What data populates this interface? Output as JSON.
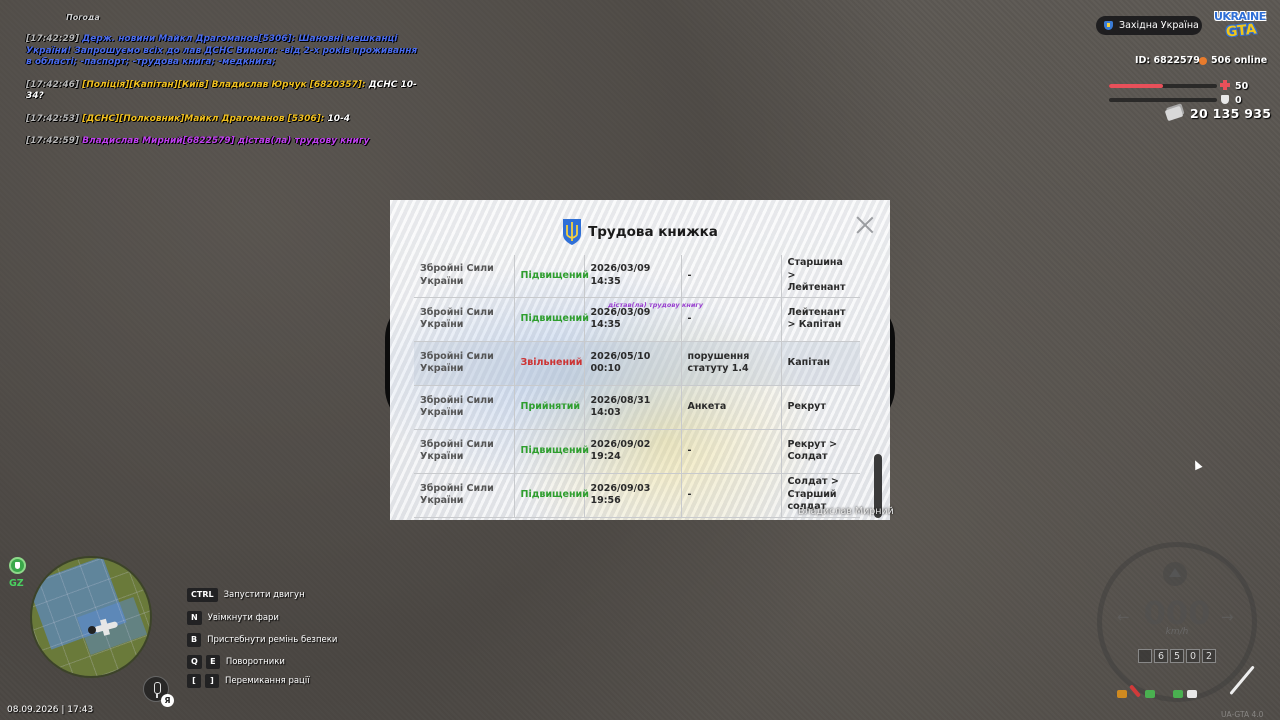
{
  "chat": {
    "first_line": "Погода",
    "lines": [
      {
        "ts": "[17:42:29]",
        "body": "Держ. новини Майкл Драгоманов[5306]: Шановні мешканці України! Запрошуємо всіх до лав ДСНС Вимоги: -від 2-х років проживання в області; -паспорт; -трудова книга; -медкнига;",
        "color": "blue"
      },
      {
        "ts": "[17:42:46]",
        "body": "[Поліція][Капітан][Київ] Владислав Юрчук [6820357]:",
        "tail": " ДСНС 10-34?",
        "color": "yellow"
      },
      {
        "ts": "[17:42:53]",
        "body": "[ДСНС][Полковник]Майкл Драгоманов [5306]:",
        "tail": " 10-4",
        "color": "yellow"
      },
      {
        "ts": "[17:42:59]",
        "body": "Владислав Мирний[6822579] дістав(ла) трудову книгу",
        "color": "purple"
      }
    ]
  },
  "hud": {
    "region": "Західна Україна",
    "logo_top": "UKRAINE",
    "logo_bottom": "GTA",
    "id_label": "ID: 6822579",
    "online": "506 online",
    "health": 50,
    "armor": 0,
    "money": "20 135 935"
  },
  "modal": {
    "title": "Трудова книжка",
    "overlay_text": "дістав(ла) трудову книгу",
    "player_name": "Владислав Мирний",
    "rows": [
      {
        "org": "Збройні Сили України",
        "status": "Підвищений",
        "status_type": "up",
        "date": "2026/03/09 14:35",
        "reason": "-",
        "rank": "Старшина > Лейтенант"
      },
      {
        "org": "Збройні Сили України",
        "status": "Підвищений",
        "status_type": "up",
        "date": "2026/03/09 14:35",
        "reason": "-",
        "rank": "Лейтенант > Капітан"
      },
      {
        "org": "Збройні Сили України",
        "status": "Звільнений",
        "status_type": "down",
        "date": "2026/05/10 00:10",
        "reason": "порушення статуту 1.4",
        "rank": "Капітан"
      },
      {
        "org": "Збройні Сили України",
        "status": "Прийнятий",
        "status_type": "up",
        "date": "2026/08/31 14:03",
        "reason": "Анкета",
        "rank": "Рекрут"
      },
      {
        "org": "Збройні Сили України",
        "status": "Підвищений",
        "status_type": "up",
        "date": "2026/09/02 19:24",
        "reason": "-",
        "rank": "Рекрут > Солдат"
      },
      {
        "org": "Збройні Сили України",
        "status": "Підвищений",
        "status_type": "up",
        "date": "2026/09/03 19:56",
        "reason": "-",
        "rank": "Солдат > Старший солдат"
      }
    ]
  },
  "minimap": {
    "zone_label": "GZ",
    "lang": "Я",
    "datetime": "08.09.2026 | 17:43"
  },
  "hints": [
    {
      "keys": [
        "CTRL"
      ],
      "label": "Запустити двигун"
    },
    {
      "keys": [
        "N"
      ],
      "label": "Увімкнути фари"
    },
    {
      "keys": [
        "B"
      ],
      "label": "Пристебнути ремінь безпеки"
    },
    {
      "keys": [
        "Q",
        "E"
      ],
      "label": "Поворотники"
    },
    {
      "keys": [
        "[",
        "]"
      ],
      "label": "Перемикання рації"
    }
  ],
  "speedometer": {
    "speed": "000",
    "unit": "km/h",
    "odometer": [
      "",
      "6",
      "5",
      "0",
      "2"
    ]
  },
  "version": "UA-GTA 4.0",
  "colors": {
    "chat_blue": "#4a6cf0",
    "chat_yellow": "#f0c020",
    "chat_purple": "#c040f0",
    "status_up": "#2e9e2e",
    "status_down": "#cc3333",
    "health": "#e8505a"
  }
}
